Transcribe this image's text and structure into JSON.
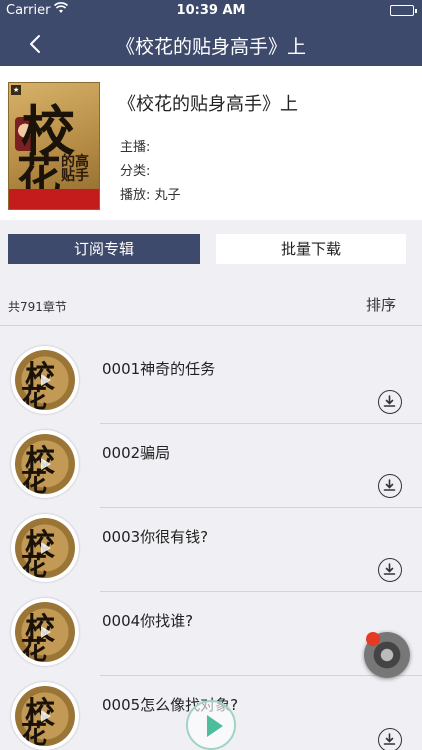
{
  "status": {
    "carrier": "Carrier",
    "time": "10:39 AM"
  },
  "nav": {
    "title": "《校花的贴身高手》上"
  },
  "album": {
    "title": "《校花的贴身高手》上",
    "host_label": "主播:",
    "host_value": "",
    "category_label": "分类:",
    "category_value": "",
    "plays_label": "播放:",
    "plays_value": "丸子"
  },
  "actions": {
    "subscribe": "订阅专辑",
    "batch_download": "批量下载"
  },
  "list_header": {
    "count": "共791章节",
    "sort": "排序"
  },
  "chapters": [
    {
      "title": "0001神奇的任务"
    },
    {
      "title": "0002骗局"
    },
    {
      "title": "0003你很有钱?"
    },
    {
      "title": "0004你找谁?"
    },
    {
      "title": "0005怎么像找对象?"
    }
  ],
  "colors": {
    "nav": "#3e4a6b",
    "accent_play": "#4dbd9b",
    "mini_player_dot": "#e53a23"
  },
  "icons": {
    "back": "chevron-left-icon",
    "download": "download-icon",
    "play": "play-icon"
  }
}
